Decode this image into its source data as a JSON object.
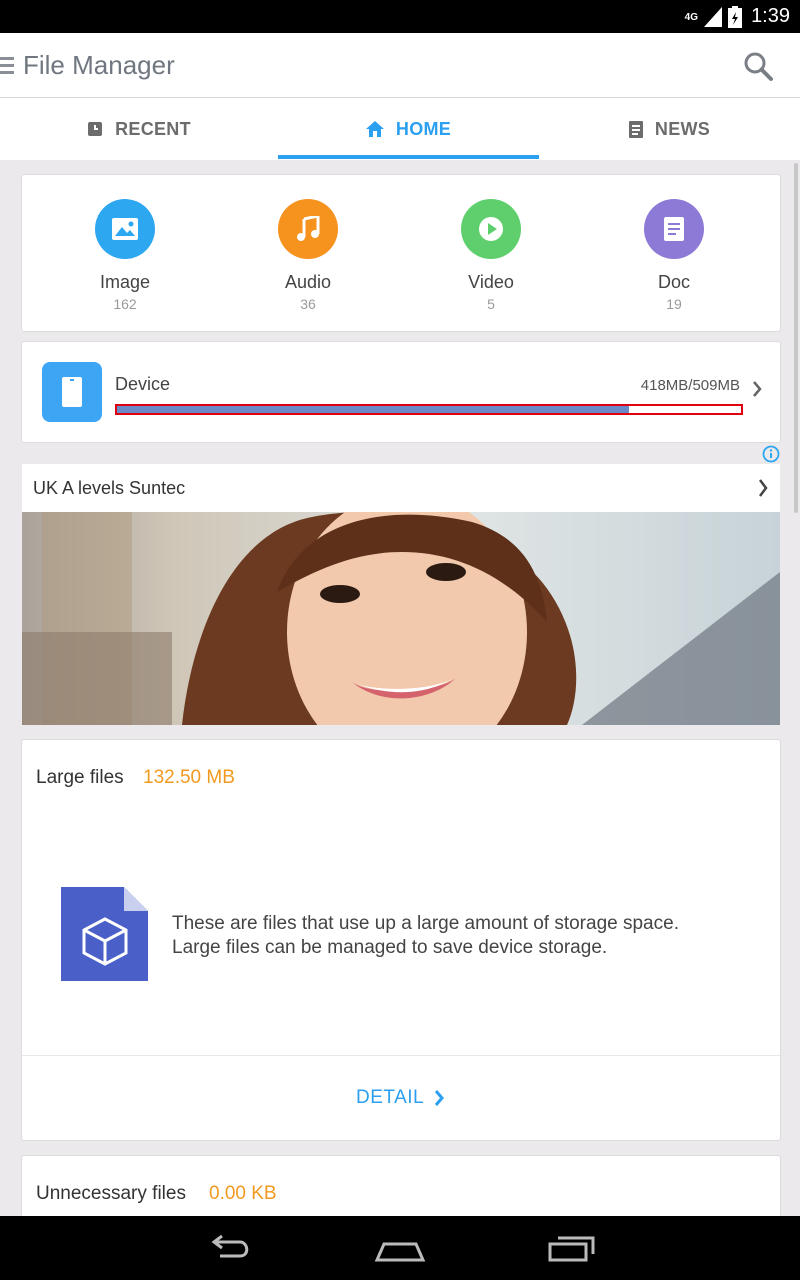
{
  "status_bar": {
    "network": "4G",
    "time": "1:39"
  },
  "app_bar": {
    "title": "File Manager"
  },
  "tabs": [
    {
      "label": "RECENT",
      "icon": "recent-icon"
    },
    {
      "label": "HOME",
      "icon": "home-icon",
      "active": true
    },
    {
      "label": "NEWS",
      "icon": "news-icon"
    }
  ],
  "categories": [
    {
      "label": "Image",
      "count": "162",
      "color": "#2ea7f1",
      "icon": "image-icon"
    },
    {
      "label": "Audio",
      "count": "36",
      "color": "#f6921e",
      "icon": "music-note-icon"
    },
    {
      "label": "Video",
      "count": "5",
      "color": "#5fcf6d",
      "icon": "play-icon"
    },
    {
      "label": "Doc",
      "count": "19",
      "color": "#8d7ad6",
      "icon": "document-icon"
    }
  ],
  "device": {
    "label": "Device",
    "used": "418MB/509MB",
    "usage_fraction": 0.82
  },
  "ad": {
    "title": "UK A levels Suntec"
  },
  "large_files": {
    "title": "Large files",
    "size": "132.50 MB",
    "description_line1": "These are files that use up a large amount of storage space.",
    "description_line2": "Large files can be managed to save device storage.",
    "detail_label": "DETAIL"
  },
  "unnecessary_files": {
    "title": "Unnecessary files",
    "size": "0.00 KB"
  },
  "colors": {
    "accent": "#2b9ff0",
    "size_orange": "#f29a1f"
  }
}
